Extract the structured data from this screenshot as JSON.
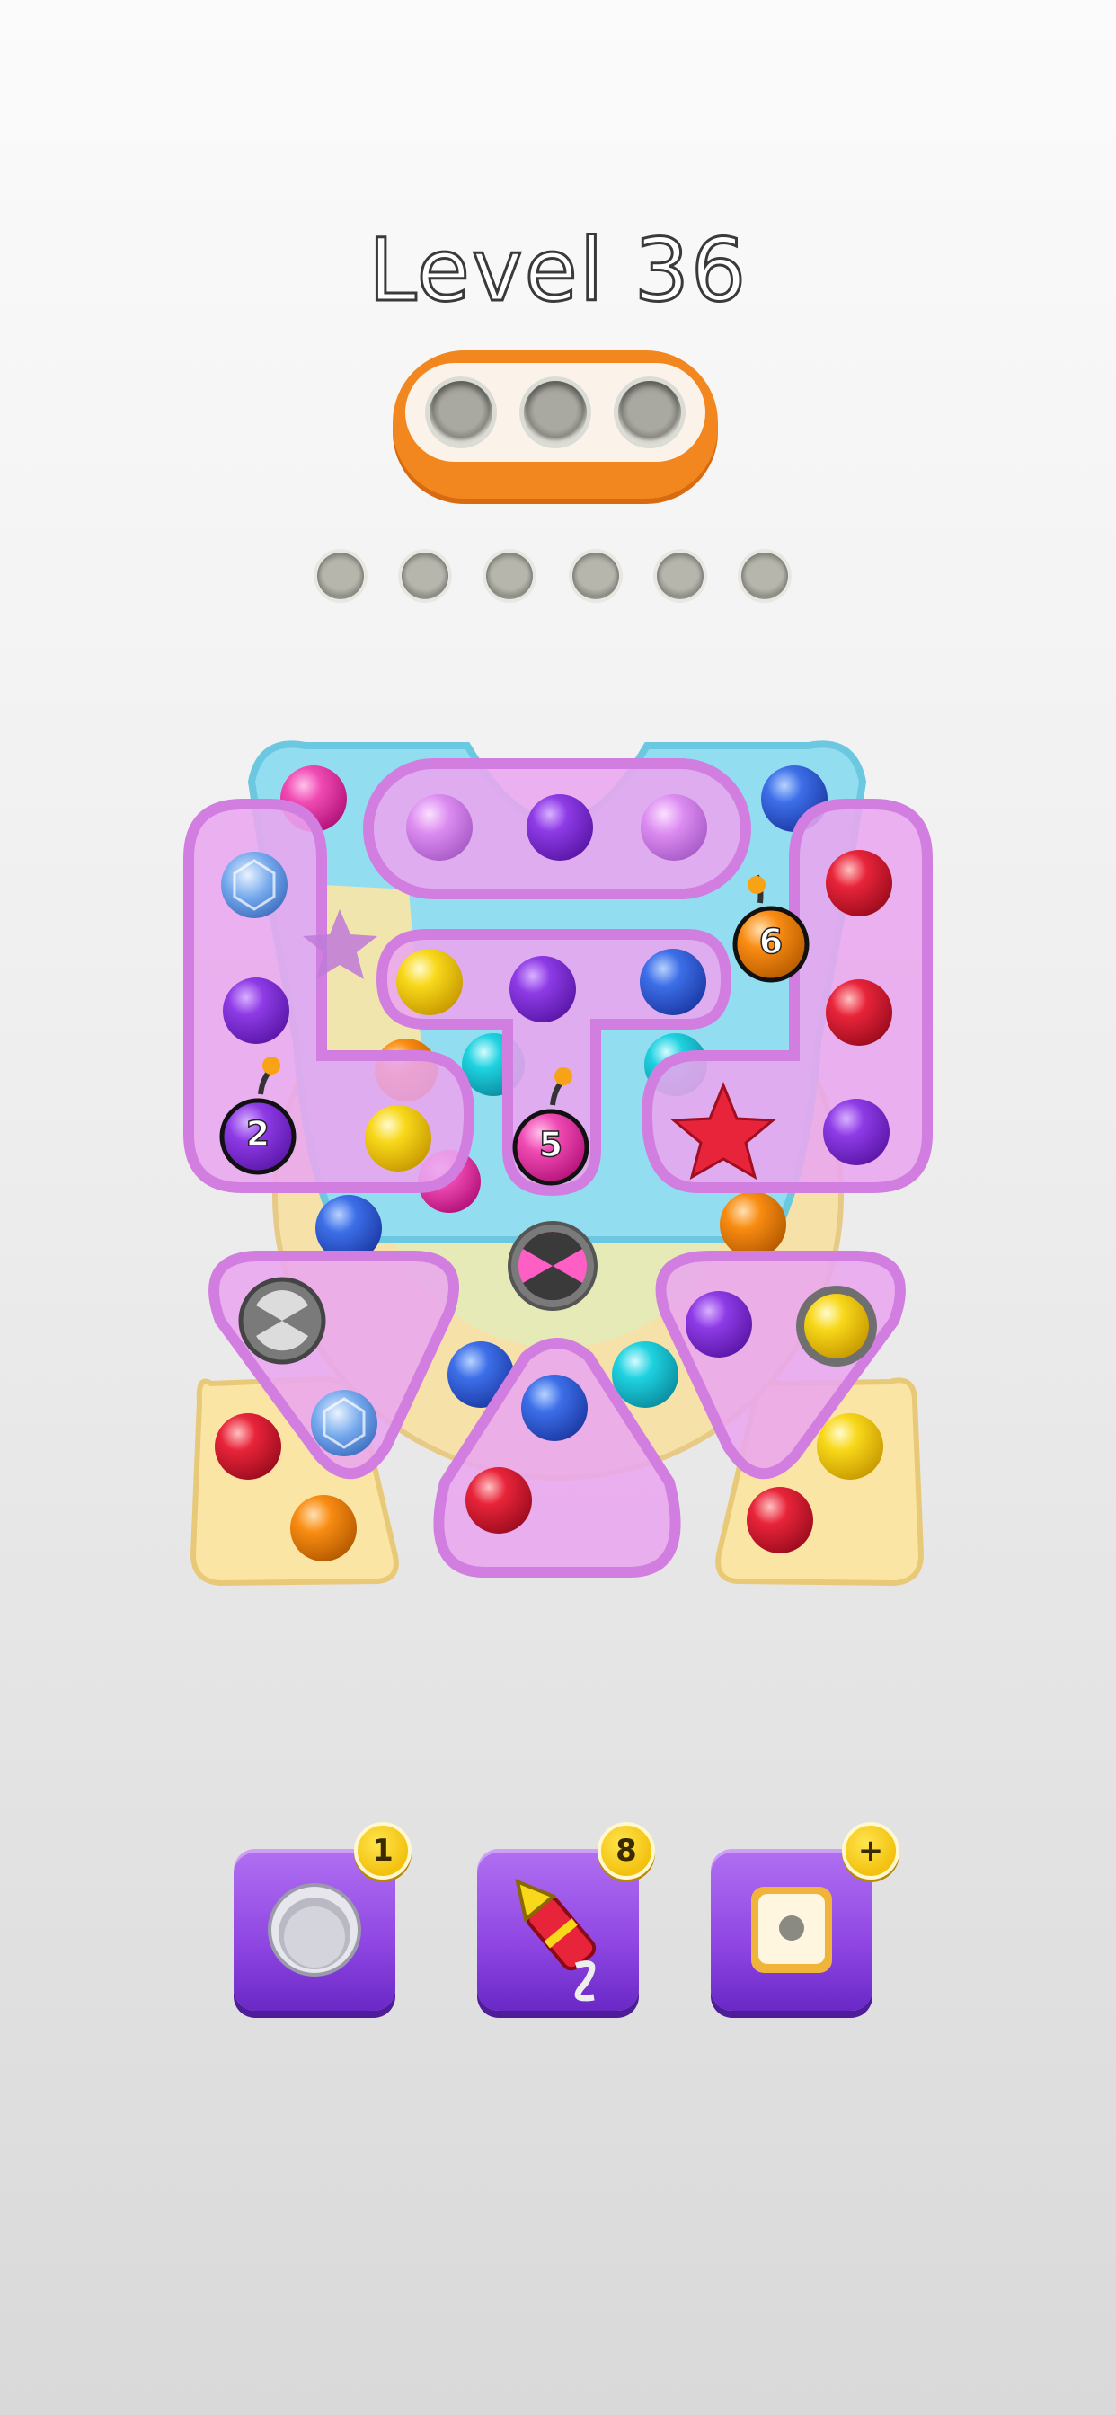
{
  "header": {
    "level_text": "Level 36"
  },
  "tray": {
    "holes": 3
  },
  "slots": {
    "count": 6
  },
  "bombs": [
    {
      "count": "2"
    },
    {
      "count": "5"
    },
    {
      "count": "6"
    }
  ],
  "boosters": [
    {
      "name": "hole-booster",
      "badge": "1"
    },
    {
      "name": "rocket-booster",
      "badge": "8"
    },
    {
      "name": "box-booster",
      "badge": "+"
    }
  ],
  "colors": {
    "plate_pink": "#e9a6ee",
    "plate_pink_border": "#d27ee0",
    "plate_cyan": "#8fe0ef",
    "plate_yellow": "#fbe5a4",
    "tray_orange": "#f2861f",
    "booster_purple": "#8e45e2",
    "badge_yellow": "#f3c10e"
  }
}
